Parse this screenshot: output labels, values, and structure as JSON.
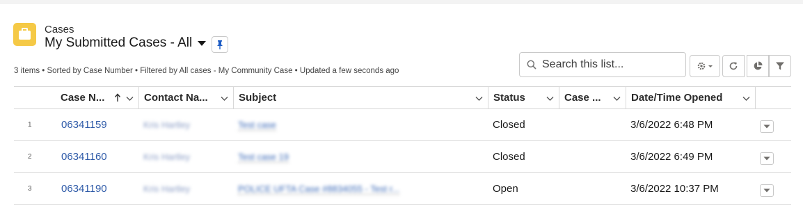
{
  "header": {
    "object_label": "Cases",
    "list_view_title": "My Submitted Cases - All",
    "meta": "3 items • Sorted by Case Number • Filtered by All cases - My Community Case • Updated a few seconds ago"
  },
  "search": {
    "placeholder": "Search this list..."
  },
  "toolbar_icons": [
    "gear-icon",
    "refresh-icon",
    "chart-icon",
    "filter-icon"
  ],
  "colors": {
    "object_icon": "#f5c946",
    "link": "#2e5aa8"
  },
  "table": {
    "columns": [
      "Case N...",
      "Contact Na...",
      "Subject",
      "Status",
      "Case ...",
      "Date/Time Opened"
    ],
    "sorted_column": "Case N...",
    "rows": [
      {
        "num": "1",
        "case_number": "06341159",
        "contact": "Kris Hartley",
        "subject": "Test case",
        "status": "Closed",
        "case_extra": "",
        "opened": "3/6/2022 6:48 PM"
      },
      {
        "num": "2",
        "case_number": "06341160",
        "contact": "Kris Hartley",
        "subject": "Test case 19",
        "status": "Closed",
        "case_extra": "",
        "opened": "3/6/2022 6:49 PM"
      },
      {
        "num": "3",
        "case_number": "06341190",
        "contact": "Kris Hartley",
        "subject": "POLICE UFTA Case #8834055 - Test r...",
        "status": "Open",
        "case_extra": "",
        "opened": "3/6/2022 10:37 PM"
      }
    ]
  }
}
